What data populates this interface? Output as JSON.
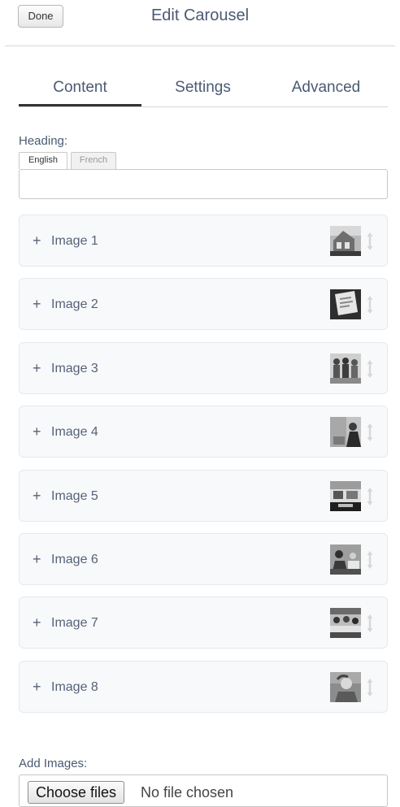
{
  "header": {
    "done_label": "Done",
    "title": "Edit Carousel"
  },
  "tabs": [
    {
      "label": "Content",
      "active": true
    },
    {
      "label": "Settings",
      "active": false
    },
    {
      "label": "Advanced",
      "active": false
    }
  ],
  "heading": {
    "label": "Heading:",
    "languages": [
      "English",
      "French"
    ],
    "active_language": "English",
    "value": ""
  },
  "images": [
    {
      "label": "Image 1",
      "expand_glyph": "+",
      "thumb_icon": "house-photo-thumbnail"
    },
    {
      "label": "Image 2",
      "expand_glyph": "+",
      "thumb_icon": "document-photo-thumbnail"
    },
    {
      "label": "Image 3",
      "expand_glyph": "+",
      "thumb_icon": "group-photo-thumbnail"
    },
    {
      "label": "Image 4",
      "expand_glyph": "+",
      "thumb_icon": "person-photo-thumbnail"
    },
    {
      "label": "Image 5",
      "expand_glyph": "+",
      "thumb_icon": "office-photo-thumbnail"
    },
    {
      "label": "Image 6",
      "expand_glyph": "+",
      "thumb_icon": "meeting-photo-thumbnail"
    },
    {
      "label": "Image 7",
      "expand_glyph": "+",
      "thumb_icon": "classroom-photo-thumbnail"
    },
    {
      "label": "Image 8",
      "expand_glyph": "+",
      "thumb_icon": "portrait-photo-thumbnail"
    }
  ],
  "add_images": {
    "label": "Add Images:",
    "button_label": "Choose files",
    "status": "No file chosen"
  },
  "colors": {
    "text": "#4a5a72",
    "active_tab_underline": "#333333",
    "item_background": "#f8f9fa"
  }
}
